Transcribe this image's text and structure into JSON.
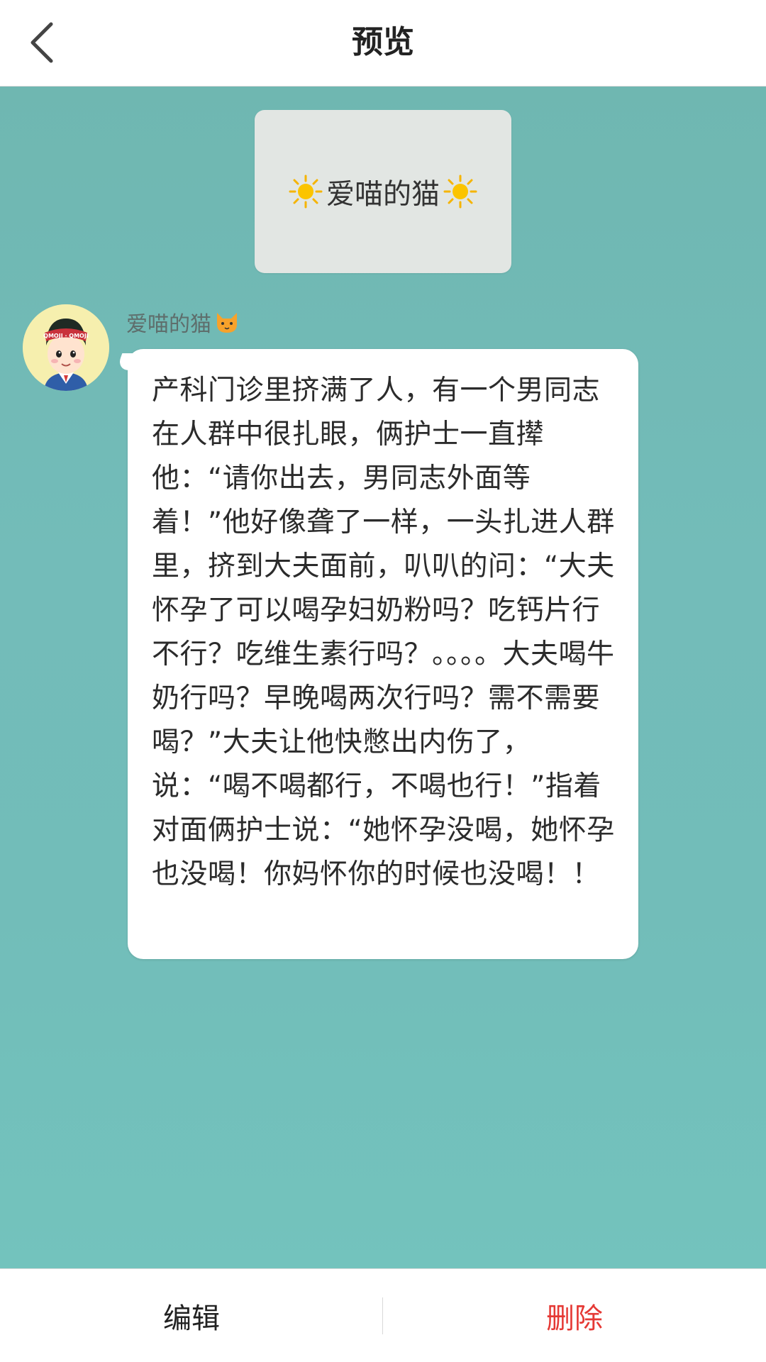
{
  "header": {
    "title": "预览",
    "back_icon": "chevron-left-icon"
  },
  "banner": {
    "text": "爱喵的猫",
    "icon": "sun-emoji-icon"
  },
  "message": {
    "sender_name": "爱喵的猫",
    "sender_icon": "cat-face-emoji-icon",
    "avatar_icon": "qmoji-boy-avatar",
    "avatar_text": "QMOJI · QMOJI",
    "body": "产科门诊里挤满了人，有一个男同志在人群中很扎眼，俩护士一直撵他：“请你出去，男同志外面等着！”他好像聋了一样，一头扎进人群里，挤到大夫面前，叭叭的问：“大夫怀孕了可以喝孕妇奶粉吗？吃钙片行不行？吃维生素行吗？。。。。大夫喝牛奶行吗？早晚喝两次行吗？需不需要喝？”大夫让他快憋出内伤了，说：“喝不喝都行，不喝也行！”指着对面俩护士说：“她怀孕没喝，她怀孕也没喝！你妈怀你的时候也没喝！！"
  },
  "footer": {
    "edit_label": "编辑",
    "delete_label": "删除"
  },
  "colors": {
    "background": "#74bfbb",
    "delete": "#e53935",
    "bubble": "#ffffff",
    "banner": "#e2e6e3"
  }
}
